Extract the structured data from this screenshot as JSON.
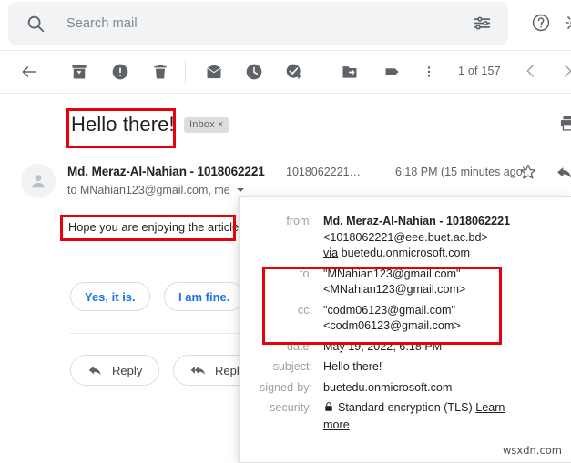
{
  "search": {
    "placeholder": "Search mail",
    "search_icon": "search-icon",
    "filter_icon": "tune-filter-icon"
  },
  "topbar": {
    "help_icon": "help-circle-icon",
    "settings_icon": "gear-icon"
  },
  "toolbar": {
    "back_icon": "arrow-back-icon",
    "archive_icon": "archive-icon",
    "spam_icon": "report-spam-icon",
    "delete_icon": "trash-delete-icon",
    "unread_icon": "mark-unread-icon",
    "snooze_icon": "clock-snooze-icon",
    "tasks_icon": "add-to-tasks-icon",
    "move_icon": "move-to-folder-icon",
    "label_icon": "label-tag-icon",
    "more_icon": "more-vertical-icon",
    "page_count": "1 of 157",
    "prev_icon": "chevron-left-icon",
    "next_icon": "chevron-right-icon"
  },
  "message": {
    "subject": "Hello there!",
    "label_chip": "Inbox",
    "label_chip_remove": "×",
    "print_icon": "print-icon",
    "avatar_icon": "person-avatar-icon",
    "sender_name": "Md. Meraz-Al-Nahian - 1018062221",
    "sender_email_truncated": "1018062221…",
    "time": "6:18 PM (15 minutes ago)",
    "star_icon": "star-icon",
    "reply_arrow_icon": "reply-arrow-icon",
    "recipients": "to MNahian123@gmail.com, me",
    "details_caret_icon": "chevron-down-icon",
    "body": "Hope you are enjoying the article"
  },
  "smart_replies": [
    {
      "label": "Yes, it is."
    },
    {
      "label": "I am fine."
    }
  ],
  "reply_buttons": [
    {
      "label": "Reply",
      "icon": "reply-arrow-icon"
    },
    {
      "label": "Repl",
      "icon": "reply-all-arrow-icon"
    }
  ],
  "details_popup": {
    "rows": [
      {
        "label": "from:",
        "value": "Md. Meraz-Al-Nahian - 1018062221"
      },
      {
        "label": "",
        "value": "<1018062221@eee.buet.ac.bd>"
      },
      {
        "label": "",
        "value_prefix": "via",
        "value": "buetedu.onmicrosoft.com"
      },
      {
        "label": "to:",
        "value": "\"MNahian123@gmail.com\""
      },
      {
        "label": "",
        "value": "<MNahian123@gmail.com>"
      },
      {
        "label": "cc:",
        "value": "\"codm06123@gmail.com\""
      },
      {
        "label": "",
        "value": "<codm06123@gmail.com>"
      },
      {
        "label": "date:",
        "value": "May 19, 2022, 6:18 PM"
      },
      {
        "label": "subject:",
        "value": "Hello there!"
      },
      {
        "label": "signed-by:",
        "value": "buetedu.onmicrosoft.com"
      },
      {
        "label": "security:",
        "value": "Standard encryption (TLS)",
        "link": "Learn more",
        "icon": "lock-icon"
      }
    ]
  },
  "annotations": {
    "color": "#e8000d",
    "boxes": [
      {
        "name": "subject-highlight"
      },
      {
        "name": "body-highlight"
      },
      {
        "name": "to-cc-highlight"
      }
    ]
  },
  "watermark": "wsxdn.com"
}
